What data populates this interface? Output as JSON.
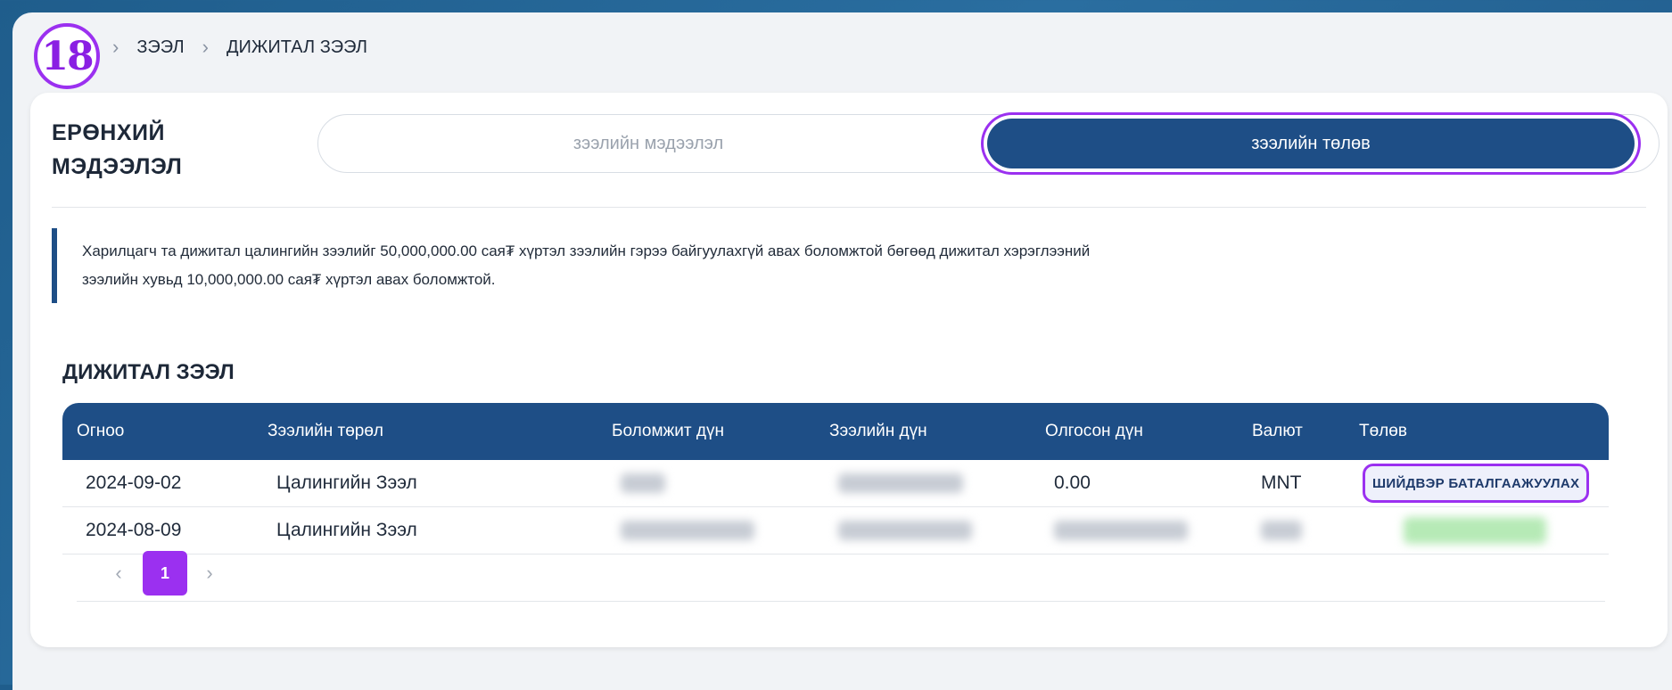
{
  "step_badge": "18",
  "breadcrumb": [
    "ЗЭЭЛ",
    "ДИЖИТАЛ ЗЭЭЛ"
  ],
  "general_title": [
    "ЕРӨНХИЙ",
    "МЭДЭЭЛЭЛ"
  ],
  "tabs": [
    "зээлийн мэдээлэл",
    "зээлийн төлөв"
  ],
  "notice": [
    "Харилцагч та дижитал цалингийн зээлийг 50,000,000.00 сая₮ хүртэл зээлийн гэрээ байгуулахгүй авах боломжтой бөгөөд дижитал хэрэглээний",
    "зээлийн хувьд 10,000,000.00 сая₮ хүртэл авах боломжтой."
  ],
  "section_title": "ДИЖИТАЛ ЗЭЭЛ",
  "table": {
    "headers": [
      "Огноо",
      "Зээлийн төрөл",
      "Боломжит дүн",
      "Зээлийн дүн",
      "Олгосон дүн",
      "Валют",
      "Төлөв"
    ],
    "rows": [
      {
        "date": "2024-09-02",
        "type": "Цалингийн Зээл",
        "issued": "0.00",
        "currency": "MNT",
        "status": "ШИЙДВЭР БАТАЛГААЖУУЛАХ"
      },
      {
        "date": "2024-08-09",
        "type": "Цалингийн Зээл"
      }
    ]
  },
  "pagination": {
    "prev": "‹",
    "page": "1",
    "next": "›"
  },
  "colors": {
    "accent": "#9b30f0",
    "primary": "#1e4e86"
  }
}
